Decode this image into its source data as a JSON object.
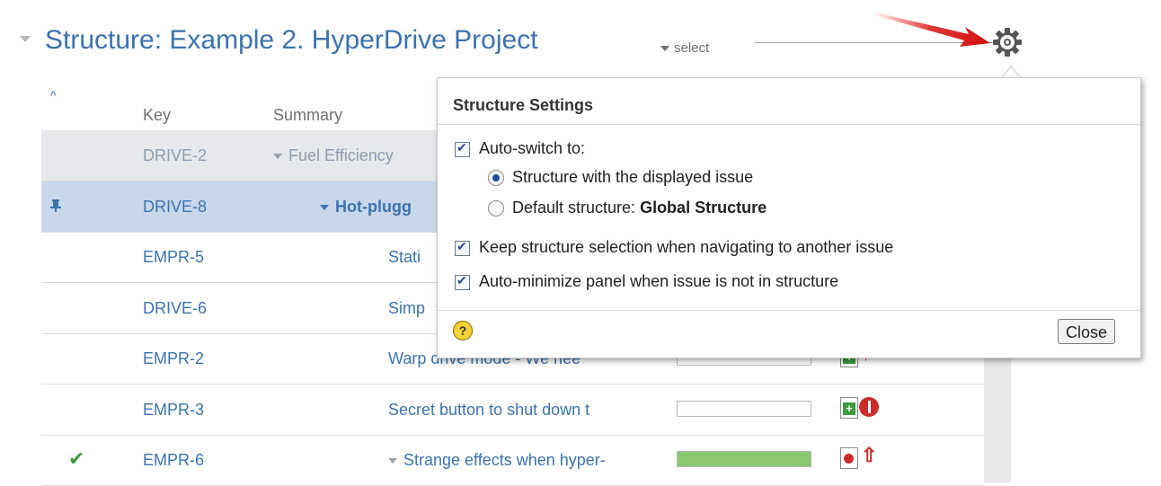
{
  "header": {
    "title": "Structure: Example 2. HyperDrive Project",
    "select_label": "select"
  },
  "table": {
    "columns": [
      "Key",
      "Summary"
    ],
    "rows": [
      {
        "key": "DRIVE-2",
        "summary": "Fuel Efficiency",
        "indent": 0,
        "has_toggle": true,
        "bold": false,
        "color": "#8c9bb0",
        "marker": "",
        "progress": null,
        "type_icon": "",
        "priority_icon": ""
      },
      {
        "key": "DRIVE-8",
        "summary": "Hot-plugg",
        "indent": 1,
        "has_toggle": true,
        "bold": true,
        "color": "#3b73af",
        "marker": "pin-icon",
        "progress": null,
        "type_icon": "",
        "priority_icon": ""
      },
      {
        "key": "EMPR-5",
        "summary": "Stati",
        "indent": 2,
        "has_toggle": false,
        "bold": false,
        "color": "#3b73af",
        "marker": "",
        "progress": null,
        "type_icon": "",
        "priority_icon": ""
      },
      {
        "key": "DRIVE-6",
        "summary": "Simp",
        "indent": 2,
        "has_toggle": false,
        "bold": false,
        "color": "#3b73af",
        "marker": "",
        "progress": null,
        "type_icon": "",
        "priority_icon": ""
      },
      {
        "key": "EMPR-2",
        "summary": "Warp drive mode - We nee",
        "indent": 2,
        "has_toggle": false,
        "bold": false,
        "color": "#3b73af",
        "marker": "",
        "progress": 0,
        "type_icon": "new-feature-icon",
        "priority_icon": "priority-critical-icon"
      },
      {
        "key": "EMPR-3",
        "summary": "Secret button to shut down t",
        "indent": 2,
        "has_toggle": false,
        "bold": false,
        "color": "#3b73af",
        "marker": "",
        "progress": 0,
        "type_icon": "new-feature-icon",
        "priority_icon": "priority-blocker-icon"
      },
      {
        "key": "EMPR-6",
        "summary": "Strange effects when hyper-",
        "indent": 2,
        "has_toggle": true,
        "bold": false,
        "color": "#3b73af",
        "marker": "check-icon",
        "progress": 1.0,
        "type_icon": "bug-icon",
        "priority_icon": "priority-major-icon"
      }
    ]
  },
  "settings_popup": {
    "title": "Structure Settings",
    "auto_switch": {
      "label": "Auto-switch to:",
      "checked": true
    },
    "radio_displayed": {
      "label": "Structure with the displayed issue",
      "selected": true
    },
    "radio_default": {
      "label_prefix": "Default structure: ",
      "label_value": "Global Structure",
      "selected": false
    },
    "keep_selection": {
      "label": "Keep structure selection when navigating to another issue",
      "checked": true
    },
    "auto_minimize": {
      "label": "Auto-minimize panel when issue is not in structure",
      "checked": true
    },
    "help_label": "?",
    "close_label": "Close"
  },
  "colors": {
    "accent": "#3b73af",
    "selected_row": "#c9d7ea",
    "shaded_row": "#e6e8ec",
    "arrow": "#e02020"
  }
}
